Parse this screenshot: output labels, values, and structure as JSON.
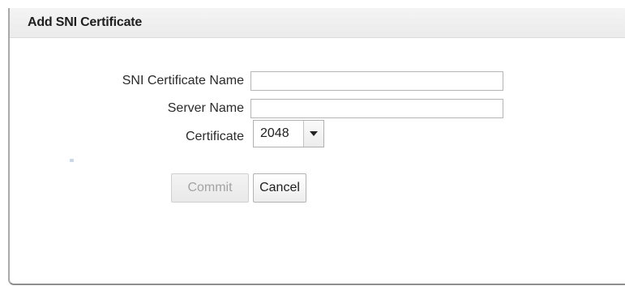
{
  "dialog": {
    "title": "Add SNI Certificate"
  },
  "form": {
    "sni_name": {
      "label": "SNI Certificate Name",
      "value": ""
    },
    "server_name": {
      "label": "Server Name",
      "value": ""
    },
    "certificate": {
      "label": "Certificate",
      "selected": "2048"
    }
  },
  "buttons": {
    "commit_label": "Commit",
    "cancel_label": "Cancel"
  },
  "icons": {
    "select_arrow": "chevron-down-icon"
  },
  "colors": {
    "header_bg": "#ececec",
    "disabled_text": "#a3a3a3",
    "border": "#b5b5b5"
  }
}
